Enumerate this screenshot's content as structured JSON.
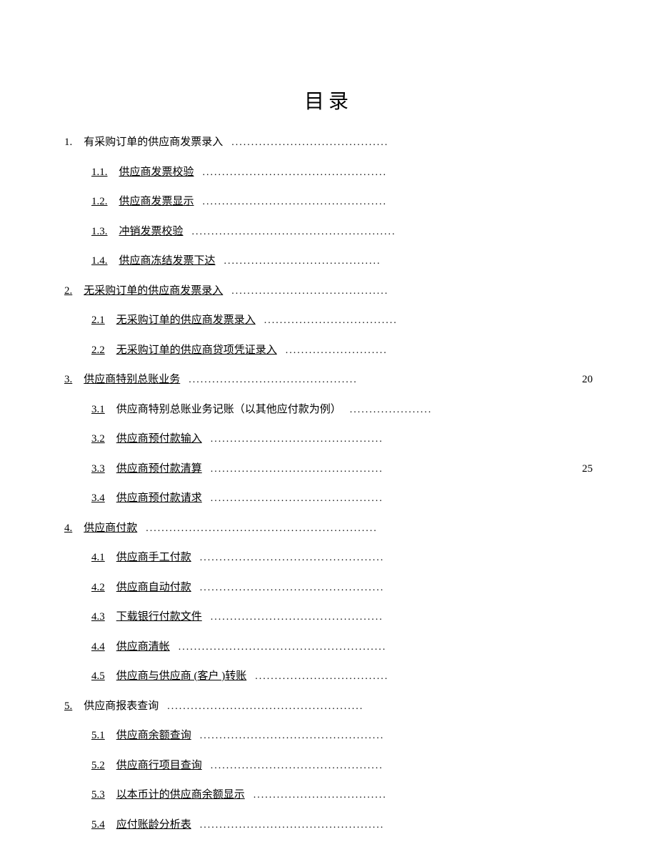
{
  "title": "目录",
  "entries": [
    {
      "level": 1,
      "num": "1.",
      "label": "有采购订单的供应商发票录入",
      "numUnderline": false,
      "labelUnderline": false,
      "leader": "........................................",
      "page": ""
    },
    {
      "level": 2,
      "num": "1.1.",
      "label": "供应商发票校验",
      "numUnderline": true,
      "labelUnderline": true,
      "leader": "...............................................",
      "page": ""
    },
    {
      "level": 2,
      "num": "1.2.",
      "label": "供应商发票显示",
      "numUnderline": true,
      "labelUnderline": true,
      "leader": "...............................................",
      "page": ""
    },
    {
      "level": 2,
      "num": "1.3.",
      "label": "冲销发票校验",
      "numUnderline": true,
      "labelUnderline": true,
      "leader": "....................................................",
      "page": ""
    },
    {
      "level": 2,
      "num": "1.4.",
      "label": "供应商冻结发票下达",
      "numUnderline": true,
      "labelUnderline": true,
      "leader": "........................................",
      "page": ""
    },
    {
      "level": 1,
      "num": "2.",
      "label": "无采购订单的供应商发票录入",
      "numUnderline": true,
      "labelUnderline": true,
      "leader": "........................................",
      "page": ""
    },
    {
      "level": 2,
      "num": "2.1",
      "label": "无采购订单的供应商发票录入",
      "numUnderline": true,
      "labelUnderline": true,
      "leader": "..................................",
      "page": ""
    },
    {
      "level": 2,
      "num": "2.2",
      "label": "无采购订单的供应商贷项凭证录入",
      "numUnderline": true,
      "labelUnderline": true,
      "leader": "..........................",
      "page": ""
    },
    {
      "level": 1,
      "num": "3.",
      "label": "供应商特别总账业务",
      "numUnderline": true,
      "labelUnderline": true,
      "leader": "...........................................",
      "page": "20"
    },
    {
      "level": 2,
      "num": "3.1",
      "label": "供应商特别总账业务记账（以其他应付款为例）",
      "numUnderline": true,
      "labelUnderline": false,
      "leader": ".....................",
      "page": ""
    },
    {
      "level": 2,
      "num": "3.2",
      "label": "供应商预付款输入",
      "numUnderline": true,
      "labelUnderline": true,
      "leader": "............................................",
      "page": ""
    },
    {
      "level": 2,
      "num": "3.3",
      "label": "供应商预付款清算",
      "numUnderline": true,
      "labelUnderline": true,
      "leader": "............................................",
      "page": "25"
    },
    {
      "level": 2,
      "num": "3.4",
      "label": "供应商预付款请求",
      "numUnderline": true,
      "labelUnderline": true,
      "leader": "............................................",
      "page": ""
    },
    {
      "level": 1,
      "num": "4.",
      "label": "供应商付款",
      "numUnderline": true,
      "labelUnderline": true,
      "leader": "...........................................................",
      "page": ""
    },
    {
      "level": 2,
      "num": "4.1",
      "label": "供应商手工付款",
      "numUnderline": true,
      "labelUnderline": true,
      "leader": "...............................................",
      "page": ""
    },
    {
      "level": 2,
      "num": "4.2",
      "label": "供应商自动付款",
      "numUnderline": true,
      "labelUnderline": true,
      "leader": "...............................................",
      "page": ""
    },
    {
      "level": 2,
      "num": "4.3",
      "label": "下载银行付款文件",
      "numUnderline": true,
      "labelUnderline": true,
      "leader": "............................................",
      "page": ""
    },
    {
      "level": 2,
      "num": "4.4",
      "label": "供应商清帐",
      "numUnderline": true,
      "labelUnderline": true,
      "leader": ".....................................................",
      "page": ""
    },
    {
      "level": 2,
      "num": "4.5",
      "label": "供应商与供应商 (客户 )转账",
      "numUnderline": true,
      "labelUnderline": true,
      "leader": "..................................",
      "page": ""
    },
    {
      "level": 1,
      "num": "5.",
      "label": "供应商报表查询",
      "numUnderline": true,
      "labelUnderline": false,
      "leader": "..................................................",
      "page": ""
    },
    {
      "level": 2,
      "num": "5.1",
      "label": "供应商余额查询",
      "numUnderline": true,
      "labelUnderline": true,
      "leader": "...............................................",
      "page": ""
    },
    {
      "level": 2,
      "num": "5.2",
      "label": "供应商行项目查询",
      "numUnderline": true,
      "labelUnderline": true,
      "leader": "............................................",
      "page": ""
    },
    {
      "level": 2,
      "num": "5.3",
      "label": "以本币计的供应商余额显示",
      "numUnderline": true,
      "labelUnderline": true,
      "leader": "..................................",
      "page": ""
    },
    {
      "level": 2,
      "num": "5.4",
      "label": "应付账龄分析表",
      "numUnderline": true,
      "labelUnderline": true,
      "leader": "...............................................",
      "page": ""
    }
  ]
}
